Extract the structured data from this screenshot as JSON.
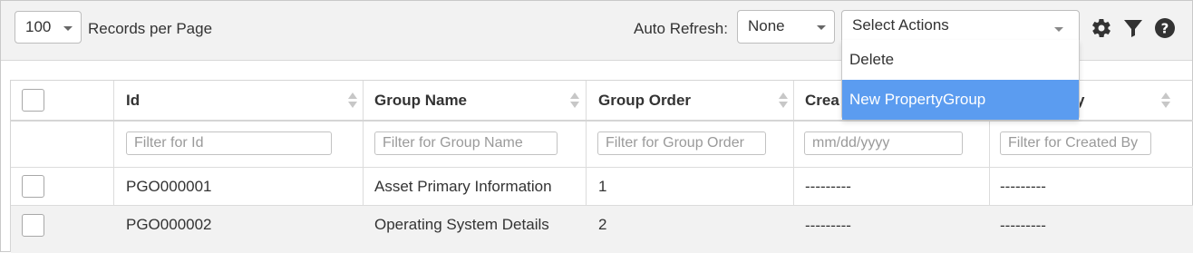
{
  "toolbar": {
    "records_value": "100",
    "records_label": "Records per Page",
    "auto_refresh_label": "Auto Refresh:",
    "auto_refresh_value": "None",
    "actions_placeholder": "Select Actions",
    "icons": [
      "gear-icon",
      "filter-icon",
      "help-icon"
    ]
  },
  "actions_menu": {
    "items": [
      "Delete",
      "New PropertyGroup"
    ],
    "highlighted": "New PropertyGroup"
  },
  "table": {
    "columns": [
      "Id",
      "Group Name",
      "Group Order",
      "Crea",
      "y"
    ],
    "filters": [
      "Filter for Id",
      "Filter for Group Name",
      "Filter for Group Order",
      "mm/dd/yyyy",
      "Filter for Created By"
    ],
    "rows": [
      {
        "id": "PGO000001",
        "group_name": "Asset Primary Information",
        "group_order": "1",
        "created_on": "---------",
        "created_by": "---------"
      },
      {
        "id": "PGO000002",
        "group_name": "Operating System Details",
        "group_order": "2",
        "created_on": "---------",
        "created_by": "---------"
      }
    ]
  },
  "colors": {
    "toolbar_bg": "#f2f2f2",
    "highlight": "#5b9cf0",
    "row_alt": "#f2f2f2"
  }
}
